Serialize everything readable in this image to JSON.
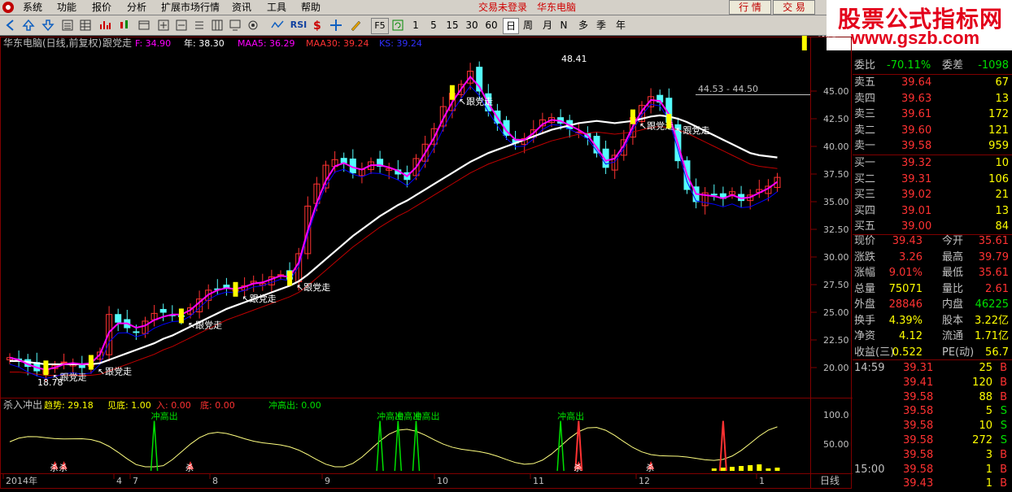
{
  "menu": {
    "items": [
      "系统",
      "功能",
      "报价",
      "分析",
      "扩展市场行情",
      "资讯",
      "工具",
      "帮助"
    ],
    "status_login": "交易未登录",
    "status_stock": "华东电脑",
    "btn_quote": "行 情",
    "btn_trade": "交 易"
  },
  "toolbar": {
    "periods": [
      "1",
      "5",
      "15",
      "30",
      "60",
      "日",
      "周",
      "月",
      "N",
      "多",
      "季",
      "年"
    ],
    "selected_period": "日",
    "rsi_label": "RSI",
    "f5_label": "F5"
  },
  "brand": {
    "line1": "股票公式指标网",
    "line2": "www.gszb.com"
  },
  "main_chart": {
    "header": {
      "stock": "华东电脑(日线,前复权)",
      "indicator": "跟党走",
      "f_label": "F: 34.90",
      "nian_label": "年: 38.30",
      "maa5_label": "MAA5: 36.29",
      "maa30_label": "MAA30: 39.24",
      "ks_label": "KS: 39.24"
    },
    "price_ticks": [
      "45.00",
      "42.50",
      "40.00",
      "37.50",
      "35.00",
      "32.50",
      "30.00",
      "27.50",
      "25.00",
      "22.50",
      "20.00"
    ],
    "high_label": "48.41",
    "low_label": "18.78",
    "range_label": "44.53 - 44.50",
    "signal_text": "跟党走",
    "signal_positions": [
      4,
      9,
      19,
      25,
      31,
      49,
      69,
      73,
      88
    ],
    "colors": {
      "up": "#ff3232",
      "down": "#54fcfc",
      "white_line": "#ffffff",
      "magenta_line": "#ff00ff",
      "blue_line": "#0000ff",
      "red_line": "#c00000",
      "signal": "#ffff00"
    }
  },
  "chart_data": {
    "type": "candlestick",
    "title": "华东电脑(日线,前复权)",
    "ylim": [
      18.5,
      47.5
    ],
    "close": [
      20.9,
      20.6,
      20.1,
      19.7,
      19.9,
      20.2,
      20.5,
      20.3,
      20.0,
      20.4,
      21.4,
      24.8,
      24.1,
      23.6,
      23.2,
      24.2,
      24.9,
      25.0,
      24.7,
      24.6,
      25.4,
      26.2,
      27.0,
      27.1,
      27.2,
      27.0,
      27.4,
      27.8,
      27.6,
      28.2,
      28.4,
      28.0,
      30.3,
      34.6,
      36.6,
      38.3,
      38.8,
      38.5,
      37.6,
      37.9,
      38.6,
      38.2,
      38.0,
      37.5,
      37.0,
      38.9,
      40.2,
      41.6,
      43.6,
      44.8,
      45.6,
      46.8,
      45.0,
      43.2,
      42.1,
      41.0,
      40.3,
      40.7,
      41.5,
      42.4,
      42.6,
      42.1,
      41.6,
      41.3,
      40.8,
      39.4,
      38.1,
      39.2,
      40.6,
      42.6,
      43.7,
      44.5,
      44.0,
      42.2,
      38.7,
      36.1,
      35.0,
      35.8,
      35.6,
      35.3,
      35.9,
      35.1,
      35.6,
      36.1,
      36.4,
      37.2
    ],
    "ma_white": [
      20.6,
      20.6,
      20.5,
      20.4,
      20.3,
      20.3,
      20.3,
      20.3,
      20.3,
      20.3,
      20.4,
      20.7,
      21.0,
      21.3,
      21.6,
      21.9,
      22.2,
      22.6,
      22.9,
      23.3,
      23.7,
      24.1,
      24.5,
      24.9,
      25.3,
      25.6,
      25.9,
      26.2,
      26.5,
      26.8,
      27.1,
      27.4,
      27.8,
      28.4,
      29.1,
      29.8,
      30.5,
      31.2,
      31.9,
      32.5,
      33.1,
      33.7,
      34.2,
      34.7,
      35.1,
      35.6,
      36.1,
      36.6,
      37.1,
      37.6,
      38.1,
      38.6,
      39.0,
      39.4,
      39.7,
      40.0,
      40.3,
      40.6,
      40.9,
      41.2,
      41.5,
      41.7,
      41.9,
      42.1,
      42.2,
      42.3,
      42.2,
      42.1,
      42.2,
      42.3,
      42.5,
      42.7,
      42.8,
      42.7,
      42.5,
      42.2,
      41.8,
      41.4,
      41.0,
      40.6,
      40.2,
      39.8,
      39.4,
      39.2,
      39.1,
      39.0
    ],
    "ma_magenta": [
      20.9,
      20.7,
      20.3,
      20.0,
      19.8,
      20.0,
      20.3,
      20.4,
      20.3,
      20.4,
      21.2,
      23.2,
      24.0,
      24.0,
      23.6,
      23.8,
      24.3,
      24.6,
      24.8,
      24.8,
      25.2,
      25.9,
      26.6,
      27.0,
      27.2,
      27.1,
      27.3,
      27.6,
      27.7,
      28.0,
      28.3,
      28.2,
      29.5,
      32.4,
      34.9,
      36.9,
      38.2,
      38.5,
      38.1,
      37.9,
      38.3,
      38.3,
      38.1,
      37.8,
      37.3,
      38.1,
      39.4,
      40.8,
      42.5,
      44.0,
      45.2,
      46.3,
      45.4,
      43.9,
      42.6,
      41.4,
      40.6,
      40.6,
      41.2,
      42.0,
      42.4,
      42.3,
      41.9,
      41.5,
      41.0,
      39.9,
      38.7,
      38.9,
      40.1,
      41.8,
      43.2,
      44.2,
      44.1,
      42.9,
      40.2,
      37.4,
      35.7,
      35.6,
      35.5,
      35.3,
      35.6,
      35.3,
      35.4,
      35.8,
      36.2,
      36.8
    ],
    "xlabels": [
      "2014年",
      "4",
      "7",
      "8",
      "9",
      "10",
      "11",
      "12",
      "1"
    ],
    "series_names": [
      "收盘",
      "MAA5",
      "MAA30",
      "KS"
    ]
  },
  "sub_chart": {
    "header": {
      "name": "杀入冲出",
      "trend_label": "趋势: 29.18",
      "see_bottom": "见底: 1.00",
      "enter": "入: 0.00",
      "bottom": "底: 0.00",
      "rush_high": "冲高出: 0.00"
    },
    "ticks": [
      "100.0",
      "50.00"
    ],
    "kill_text": "杀",
    "rush_text": "冲高出"
  },
  "x_axis": {
    "labels": [
      "2014年",
      "4",
      "7",
      "8",
      "9",
      "10",
      "11",
      "12",
      "1"
    ],
    "tab": "日线"
  },
  "quote_panel": {
    "stock_name": "华东电脑",
    "weibi_label": "委比",
    "weibi_value": "-70.11%",
    "weicha_label": "委差",
    "weicha_value": "-1098",
    "asks": [
      {
        "label": "卖五",
        "price": "39.64",
        "vol": "67"
      },
      {
        "label": "卖四",
        "price": "39.63",
        "vol": "13"
      },
      {
        "label": "卖三",
        "price": "39.61",
        "vol": "172"
      },
      {
        "label": "卖二",
        "price": "39.60",
        "vol": "121"
      },
      {
        "label": "卖一",
        "price": "39.58",
        "vol": "959"
      }
    ],
    "bids": [
      {
        "label": "买一",
        "price": "39.32",
        "vol": "10"
      },
      {
        "label": "买二",
        "price": "39.31",
        "vol": "106"
      },
      {
        "label": "买三",
        "price": "39.02",
        "vol": "21"
      },
      {
        "label": "买四",
        "price": "39.01",
        "vol": "13"
      },
      {
        "label": "买五",
        "price": "39.00",
        "vol": "84"
      }
    ],
    "stats": [
      {
        "l1": "现价",
        "v1": "39.43",
        "l2": "今开",
        "v2": "35.61",
        "c1": "#ff3232",
        "c2": "#ff3232"
      },
      {
        "l1": "涨跌",
        "v1": "3.26",
        "l2": "最高",
        "v2": "39.79",
        "c1": "#ff3232",
        "c2": "#ff3232"
      },
      {
        "l1": "涨幅",
        "v1": "9.01%",
        "l2": "最低",
        "v2": "35.61",
        "c1": "#ff3232",
        "c2": "#ff3232"
      },
      {
        "l1": "总量",
        "v1": "75071",
        "l2": "量比",
        "v2": "2.61",
        "c1": "#ffff00",
        "c2": "#ff3232"
      },
      {
        "l1": "外盘",
        "v1": "28846",
        "l2": "内盘",
        "v2": "46225",
        "c1": "#ff3232",
        "c2": "#00e000"
      },
      {
        "l1": "换手",
        "v1": "4.39%",
        "l2": "股本",
        "v2": "3.22亿",
        "c1": "#ffff00",
        "c2": "#ffff00"
      },
      {
        "l1": "净资",
        "v1": "4.12",
        "l2": "流通",
        "v2": "1.71亿",
        "c1": "#ffff00",
        "c2": "#ffff00"
      },
      {
        "l1": "收益(三)",
        "v1": "0.522",
        "l2": "PE(动)",
        "v2": "56.7",
        "c1": "#ffff00",
        "c2": "#ffff00"
      }
    ],
    "ticks": [
      {
        "time": "14:59",
        "price": "39.31",
        "vol": "25",
        "bs": "B"
      },
      {
        "time": "",
        "price": "39.41",
        "vol": "120",
        "bs": "B"
      },
      {
        "time": "",
        "price": "39.58",
        "vol": "88",
        "bs": "B"
      },
      {
        "time": "",
        "price": "39.58",
        "vol": "5",
        "bs": "S"
      },
      {
        "time": "",
        "price": "39.58",
        "vol": "10",
        "bs": "S"
      },
      {
        "time": "",
        "price": "39.58",
        "vol": "272",
        "bs": "S"
      },
      {
        "time": "",
        "price": "39.58",
        "vol": "3",
        "bs": "B"
      },
      {
        "time": "15:00",
        "price": "39.58",
        "vol": "1",
        "bs": "B"
      },
      {
        "time": "",
        "price": "39.43",
        "vol": "1",
        "bs": "B"
      }
    ]
  }
}
